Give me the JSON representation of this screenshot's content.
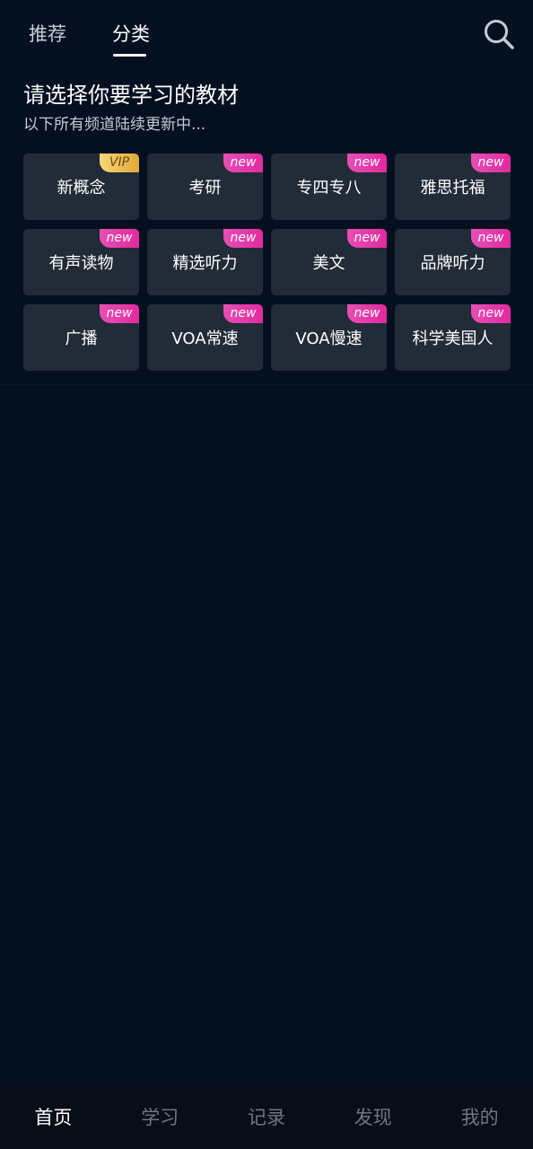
{
  "header": {
    "tabs": [
      {
        "label": "推荐",
        "active": false
      },
      {
        "label": "分类",
        "active": true
      }
    ],
    "search_icon": "search-icon"
  },
  "intro": {
    "title": "请选择你要学习的教材",
    "subtitle": "以下所有频道陆续更新中..."
  },
  "categories": [
    {
      "label": "新概念",
      "badge": "VIP"
    },
    {
      "label": "考研",
      "badge": "new"
    },
    {
      "label": "专四专八",
      "badge": "new"
    },
    {
      "label": "雅思托福",
      "badge": "new"
    },
    {
      "label": "有声读物",
      "badge": "new"
    },
    {
      "label": "精选听力",
      "badge": "new"
    },
    {
      "label": "美文",
      "badge": "new"
    },
    {
      "label": "品牌听力",
      "badge": "new"
    },
    {
      "label": "广播",
      "badge": "new"
    },
    {
      "label": "VOA常速",
      "badge": "new"
    },
    {
      "label": "VOA慢速",
      "badge": "new"
    },
    {
      "label": "科学美国人",
      "badge": "new"
    }
  ],
  "bottom_nav": [
    {
      "label": "首页",
      "active": true
    },
    {
      "label": "学习",
      "active": false
    },
    {
      "label": "记录",
      "active": false
    },
    {
      "label": "发现",
      "active": false
    },
    {
      "label": "我的",
      "active": false
    }
  ],
  "colors": {
    "background": "#041020",
    "tile": "#222b38",
    "badge_new": "#e22a9f",
    "badge_vip": "#e0a83a",
    "nav_inactive": "#6f7682"
  }
}
